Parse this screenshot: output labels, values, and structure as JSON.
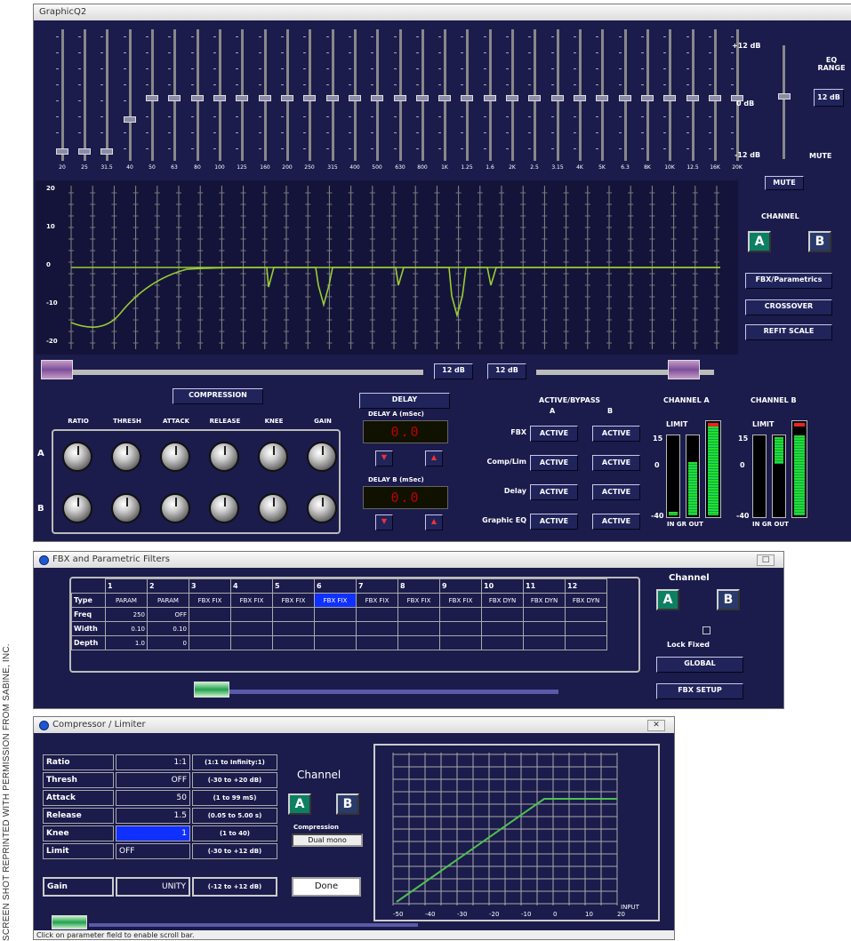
{
  "credit": "SCREEN SHOT REPRINTED WITH PERMISSION FROM SABINE, INC.",
  "graphic": {
    "title": "GraphicQ2",
    "bands": [
      "20",
      "25",
      "31.5",
      "40",
      "50",
      "63",
      "80",
      "100",
      "125",
      "160",
      "200",
      "250",
      "315",
      "400",
      "500",
      "630",
      "800",
      "1K",
      "1.25",
      "1.6",
      "2K",
      "2.5",
      "3.15",
      "4K",
      "5K",
      "6.3",
      "8K",
      "10K",
      "12.5",
      "16K",
      "20K"
    ],
    "band_levels": [
      -10,
      -10,
      -10,
      -4,
      0,
      0,
      0,
      0,
      0,
      0,
      0,
      0,
      0,
      0,
      0,
      0,
      0,
      0,
      0,
      0,
      0,
      0,
      0,
      0,
      0,
      0,
      0,
      0,
      0,
      0,
      0
    ],
    "range_scale": [
      "+12 dB",
      "0 dB",
      "-12 dB"
    ],
    "range_label": "EQ RANGE",
    "range_value": "12 dB",
    "mute_label": "MUTE",
    "mute_button": "MUTE",
    "plot_y_labels": [
      "20",
      "10",
      "0",
      "-10",
      "-20"
    ],
    "channel_label": "CHANNEL",
    "channel_a": "A",
    "channel_b": "B",
    "fbx_button": "FBX/Parametrics",
    "crossover_button": "CROSSOVER",
    "refit_button": "REFIT SCALE",
    "scroll_left": "12 dB",
    "scroll_right": "12 dB",
    "compression_button": "COMPRESSION",
    "knob_headers": [
      "RATIO",
      "THRESH",
      "ATTACK",
      "RELEASE",
      "KNEE",
      "GAIN"
    ],
    "row_a": "A",
    "row_b": "B",
    "delay_button": "DELAY",
    "delay_a_label": "DELAY A (mSec)",
    "delay_b_label": "DELAY B (mSec)",
    "delay_a_value": "0.0",
    "delay_b_value": "0.0",
    "active_bypass": "ACTIVE/BYPASS",
    "ab_a": "A",
    "ab_b": "B",
    "bypass_rows": [
      {
        "label": "FBX",
        "a": "ACTIVE",
        "b": "ACTIVE"
      },
      {
        "label": "Comp/Lim",
        "a": "ACTIVE",
        "b": "ACTIVE"
      },
      {
        "label": "Delay",
        "a": "ACTIVE",
        "b": "ACTIVE"
      },
      {
        "label": "Graphic EQ",
        "a": "ACTIVE",
        "b": "ACTIVE"
      }
    ],
    "channel_a_title": "CHANNEL A",
    "channel_b_title": "CHANNEL B",
    "limit_label": "LIMIT",
    "meter_scale": [
      "15",
      "0",
      "-40"
    ],
    "meter_foot": "IN GR OUT",
    "colors": {
      "panel": "#1b1b4c",
      "curve": "#9acd32",
      "meter": "#2bdc2b",
      "led": "#b00000"
    }
  },
  "fbx": {
    "title": "FBX and Parametric Filters",
    "columns": [
      "1",
      "2",
      "3",
      "4",
      "5",
      "6",
      "7",
      "8",
      "9",
      "10",
      "11",
      "12"
    ],
    "row_labels": [
      "Type",
      "Freq",
      "Width",
      "Depth"
    ],
    "types": [
      "PARAM",
      "PARAM",
      "FBX FIX",
      "FBX FIX",
      "FBX FIX",
      "FBX FIX",
      "FBX FIX",
      "FBX FIX",
      "FBX FIX",
      "FBX DYN",
      "FBX DYN",
      "FBX DYN"
    ],
    "freq": [
      "250",
      "OFF",
      "",
      "",
      "",
      "",
      "",
      "",
      "",
      "",
      "",
      ""
    ],
    "width": [
      "0.10",
      "0.10",
      "",
      "",
      "",
      "",
      "",
      "",
      "",
      "",
      "",
      ""
    ],
    "depth": [
      "1.0",
      "0",
      "",
      "",
      "",
      "",
      "",
      "",
      "",
      "",
      "",
      ""
    ],
    "channel_label": "Channel",
    "channel_a": "A",
    "channel_b": "B",
    "lock_fixed": "Lock Fixed",
    "global_button": "GLOBAL",
    "setup_button": "FBX SETUP"
  },
  "comp": {
    "title": "Compressor / Limiter",
    "rows": [
      {
        "name": "Ratio",
        "value": "1:1",
        "range": "(1:1 to Infinity:1)"
      },
      {
        "name": "Thresh",
        "value": "OFF",
        "range": "(-30 to +20 dB)"
      },
      {
        "name": "Attack",
        "value": "50",
        "range": "(1 to 99 mS)"
      },
      {
        "name": "Release",
        "value": "1.5",
        "range": "(0.05 to 5.00 s)"
      },
      {
        "name": "Knee",
        "value": "1",
        "range": "(1 to 40)"
      },
      {
        "name": "Limit",
        "value": "OFF",
        "range": "(-30 to +12 dB)"
      }
    ],
    "gain": {
      "name": "Gain",
      "value": "UNITY",
      "range": "(-12 to +12 dB)"
    },
    "channel_label": "Channel",
    "channel_a": "A",
    "channel_b": "B",
    "compression_label": "Compression",
    "dual_mono": "Dual mono",
    "done": "Done",
    "graph_x": [
      "-50",
      "-40",
      "-30",
      "-20",
      "-10",
      "0",
      "10",
      "20"
    ],
    "graph_unit": "INPUT",
    "status": "Click on parameter field to enable scroll bar."
  }
}
